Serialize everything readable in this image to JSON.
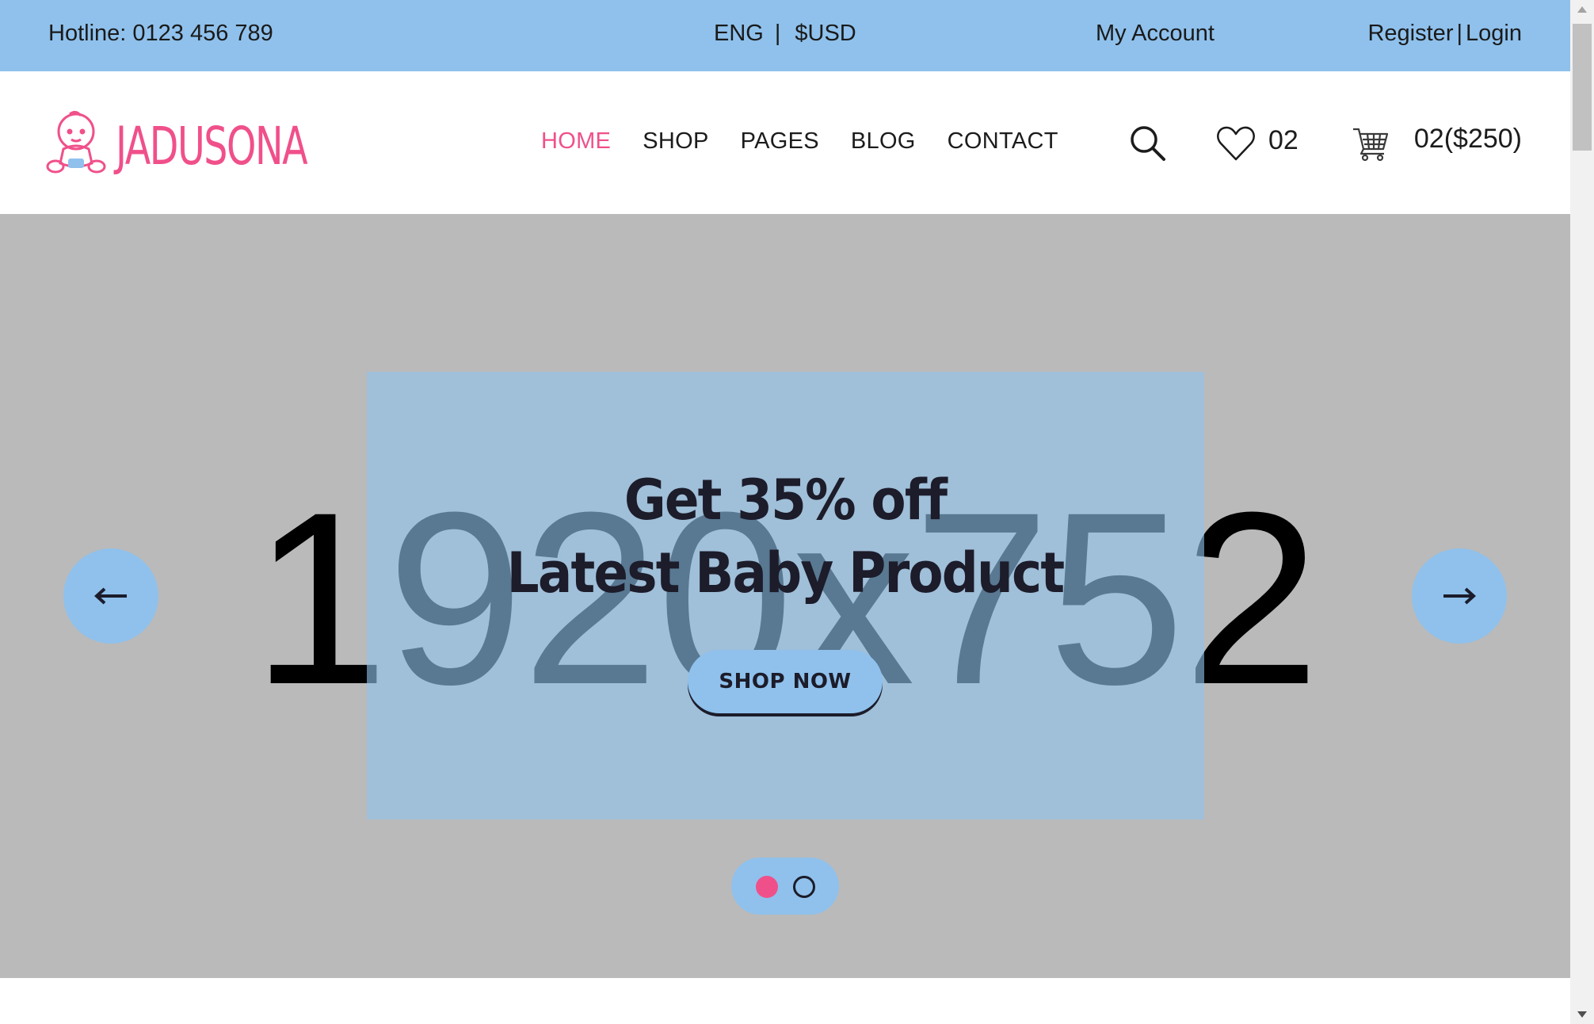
{
  "topbar": {
    "hotline": "Hotline: 0123 456 789",
    "language": "ENG",
    "separator": "|",
    "currency": "$USD",
    "my_account": "My Account",
    "register": "Register",
    "login": "Login"
  },
  "header": {
    "logo_text": "JADUSONA",
    "nav": [
      "HOME",
      "SHOP",
      "PAGES",
      "BLOG",
      "CONTACT"
    ],
    "active_nav": "HOME",
    "wishlist_count": "02",
    "cart_summary": "02($250)"
  },
  "hero": {
    "placeholder": "1920x752",
    "headline_line1": "Get 35% off",
    "headline_line2": "Latest Baby Product",
    "cta": "SHOP NOW",
    "slide_count": 2,
    "active_slide": 1
  },
  "colors": {
    "accent_blue": "#8fc1ec",
    "accent_pink": "#f0508a",
    "hero_bg": "#bababa",
    "text_dark": "#1c1c2a"
  },
  "icons": {
    "search": "search-icon",
    "wishlist": "heart-icon",
    "cart": "cart-icon",
    "prev": "arrow-left-icon",
    "next": "arrow-right-icon"
  }
}
